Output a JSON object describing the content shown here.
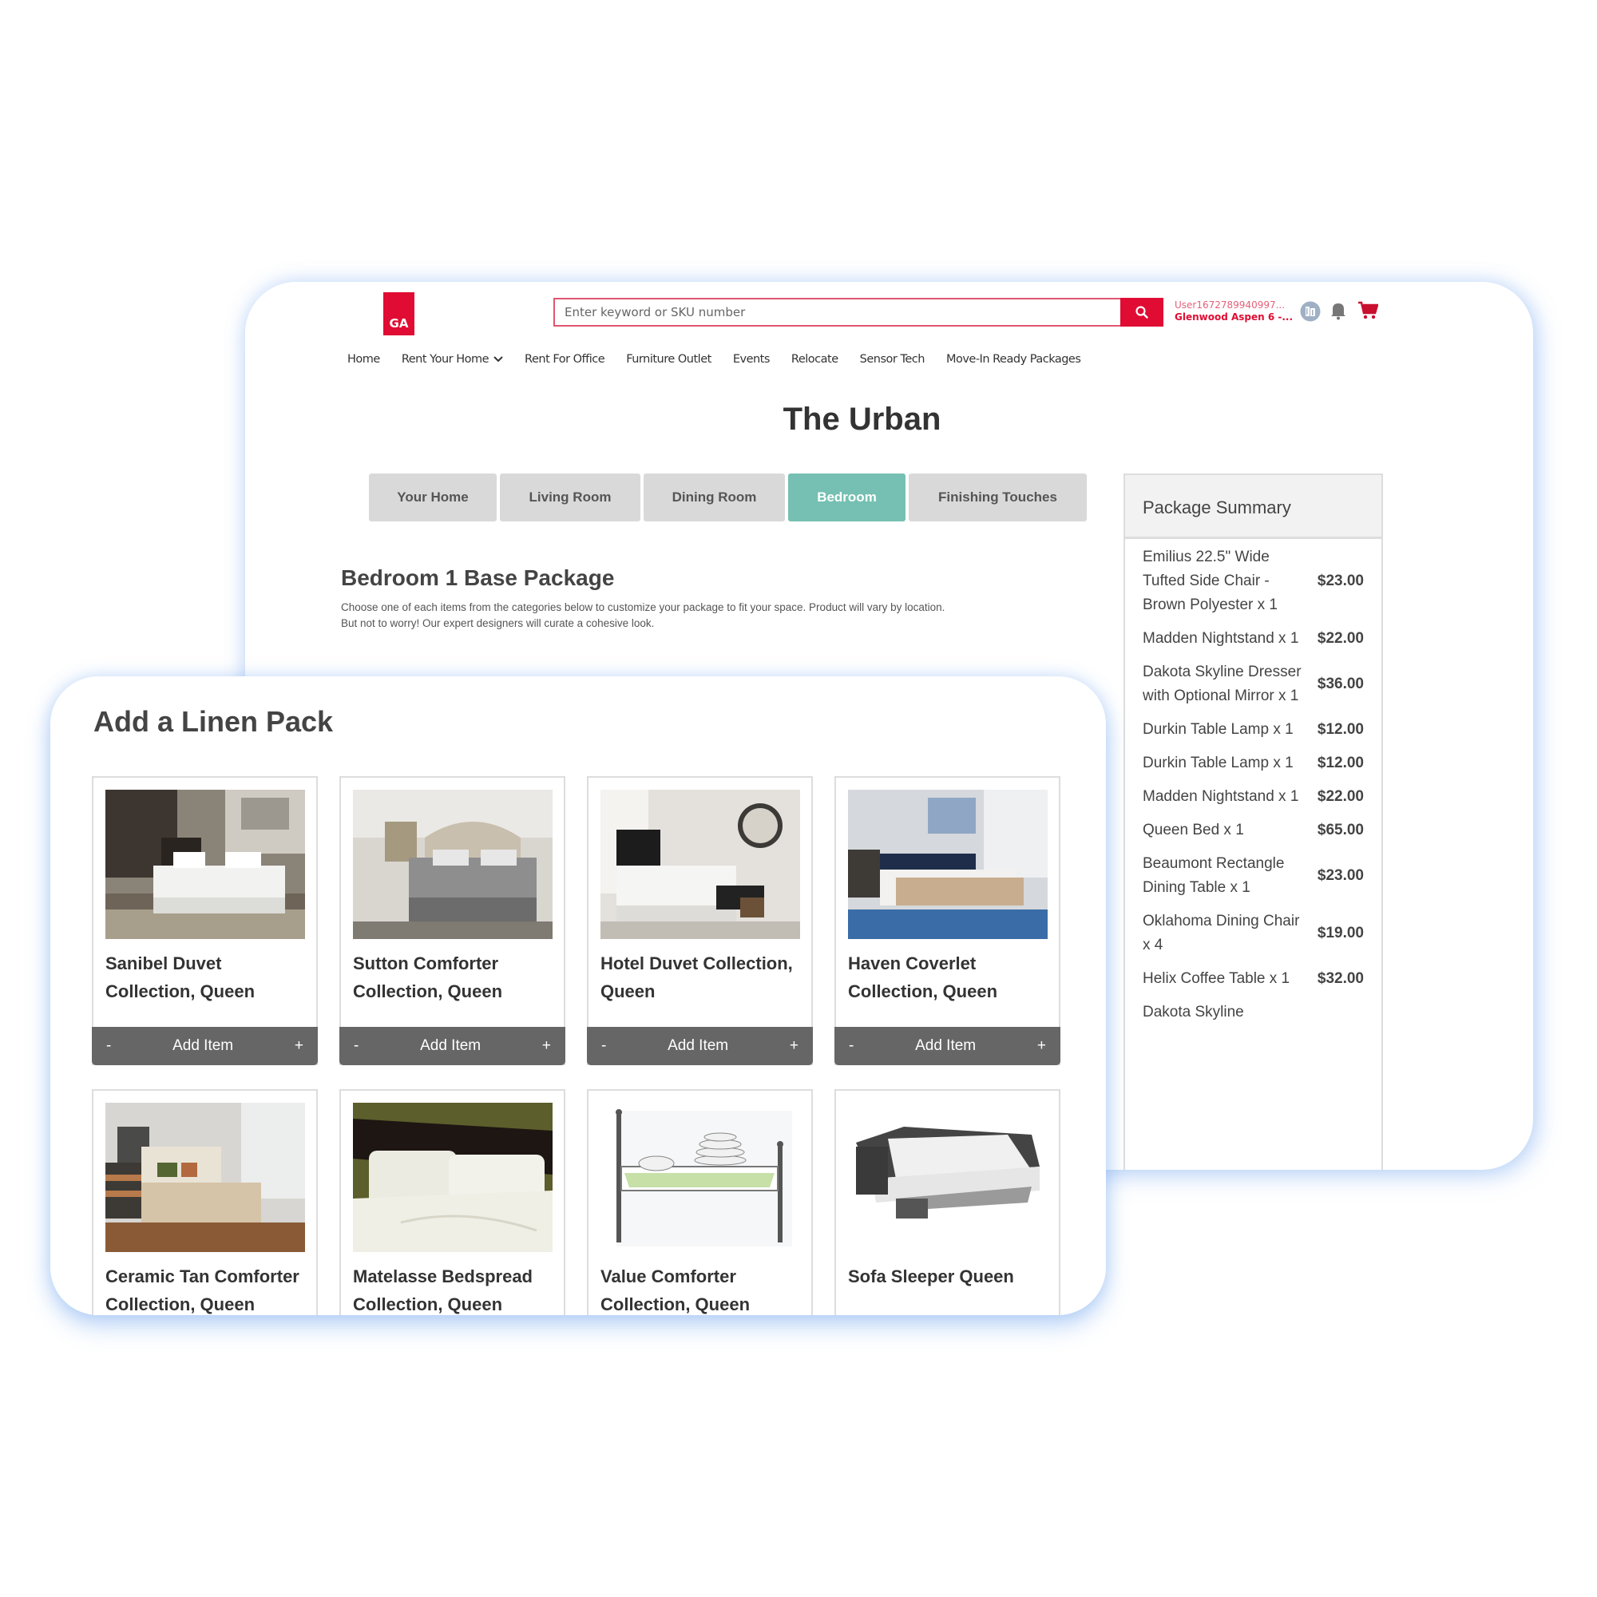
{
  "header": {
    "logo_text": "GA",
    "search_placeholder": "Enter keyword or SKU number",
    "user_id": "User1672789940997...",
    "user_location": "Glenwood Aspen 6 -...",
    "icons": [
      "building-avatar-icon",
      "bell-icon",
      "cart-icon"
    ]
  },
  "nav": {
    "items": [
      {
        "label": "Home"
      },
      {
        "label": "Rent Your Home",
        "has_dropdown": true
      },
      {
        "label": "Rent For Office"
      },
      {
        "label": "Furniture Outlet"
      },
      {
        "label": "Events"
      },
      {
        "label": "Relocate"
      },
      {
        "label": "Sensor Tech"
      },
      {
        "label": "Move-In Ready Packages"
      }
    ]
  },
  "page": {
    "title": "The Urban",
    "tabs": [
      {
        "label": "Your Home",
        "active": false
      },
      {
        "label": "Living Room",
        "active": false
      },
      {
        "label": "Dining Room",
        "active": false
      },
      {
        "label": "Bedroom",
        "active": true
      },
      {
        "label": "Finishing Touches",
        "active": false
      }
    ],
    "section_title": "Bedroom 1 Base Package",
    "section_desc": "Choose one of each items from the categories below to customize your package to fit your space. Product will vary by location. But not to worry! Our expert designers will curate a cohesive look."
  },
  "summary": {
    "title": "Package Summary",
    "items": [
      {
        "name": "Emilius 22.5\" Wide Tufted Side Chair - Brown Polyester x 1",
        "price": "$23.00"
      },
      {
        "name": "Madden Nightstand x 1",
        "price": "$22.00"
      },
      {
        "name": "Dakota Skyline Dresser with Optional Mirror x 1",
        "price": "$36.00"
      },
      {
        "name": "Durkin Table Lamp x 1",
        "price": "$12.00"
      },
      {
        "name": "Durkin Table Lamp x 1",
        "price": "$12.00"
      },
      {
        "name": "Madden Nightstand x 1",
        "price": "$22.00"
      },
      {
        "name": "Queen Bed x 1",
        "price": "$65.00"
      },
      {
        "name": "Beaumont Rectangle Dining Table x 1",
        "price": "$23.00"
      },
      {
        "name": "Oklahoma Dining Chair x 4",
        "price": "$19.00"
      },
      {
        "name": "Helix Coffee Table x 1",
        "price": "$32.00"
      },
      {
        "name": "Dakota Skyline",
        "price": ""
      }
    ]
  },
  "linen": {
    "title": "Add a Linen Pack",
    "action": {
      "minus": "-",
      "label": "Add Item",
      "plus": "+"
    },
    "products": [
      {
        "name": "Sanibel Duvet Collection, Queen",
        "image": "bedroom-photo"
      },
      {
        "name": "Sutton Comforter Collection, Queen",
        "image": "bedroom-photo"
      },
      {
        "name": "Hotel Duvet Collection, Queen",
        "image": "bedroom-photo"
      },
      {
        "name": "Haven Coverlet Collection, Queen",
        "image": "bedroom-photo"
      },
      {
        "name": "Ceramic Tan Comforter Collection, Queen",
        "image": "bedroom-photo"
      },
      {
        "name": "Matelasse Bedspread Collection, Queen",
        "image": "bedding-photo"
      },
      {
        "name": "Value Comforter Collection, Queen",
        "image": "bed-illustration"
      },
      {
        "name": "Sofa Sleeper Queen",
        "image": "sofa-sleeper-photo"
      }
    ]
  },
  "colors": {
    "brand_red": "#e00c33",
    "active_tab": "#75c0b2",
    "action_bar": "#666666"
  }
}
